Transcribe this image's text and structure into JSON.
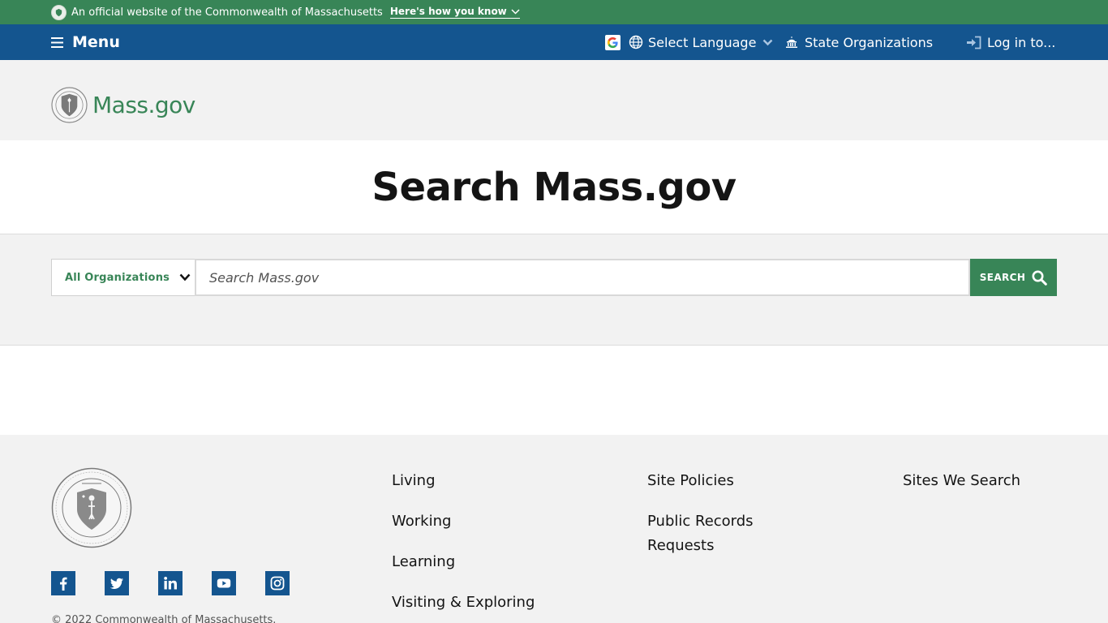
{
  "gov_banner": {
    "text": "An official website of the Commonwealth of Massachusetts",
    "toggle_label": "Here's how you know"
  },
  "utility_nav": {
    "menu_label": "Menu",
    "language_label": "Select Language",
    "orgs_label": "State Organizations",
    "login_label": "Log in to..."
  },
  "header": {
    "logo_text": "Mass.gov"
  },
  "page": {
    "title": "Search Mass.gov"
  },
  "search": {
    "org_filter_label": "All Organizations",
    "placeholder": "Search Mass.gov",
    "value": "",
    "button_label": "SEARCH"
  },
  "footer": {
    "column1": [
      "Living",
      "Working",
      "Learning",
      "Visiting & Exploring"
    ],
    "column2": [
      "Site Policies",
      "Public Records Requests"
    ],
    "column3": [
      "Sites We Search"
    ],
    "socials": [
      "facebook-icon",
      "twitter-icon",
      "linkedin-icon",
      "youtube-icon",
      "instagram-icon"
    ],
    "copyright": "© 2022 Commonwealth of Massachusetts."
  },
  "colors": {
    "banner_green": "#388557",
    "nav_blue": "#14558f",
    "band_gray": "#f2f2f2"
  }
}
